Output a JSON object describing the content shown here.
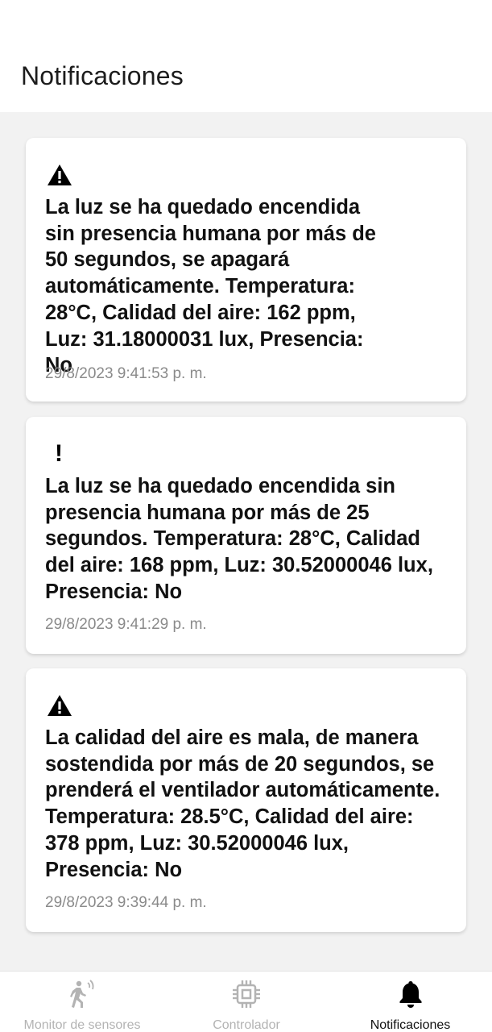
{
  "header": {
    "title": "Notificaciones"
  },
  "notifications": [
    {
      "icon": "warning-triangle-icon",
      "message": "La luz se ha quedado encendida sin presencia humana por más de 50 segundos, se apagará automáticamente. Temperatura: 28°C, Calidad del aire: 162 ppm, Luz: 31.18000031 lux, Presencia: No",
      "timestamp": "29/8/2023 9:41:53 p. m."
    },
    {
      "icon": "exclamation-icon",
      "icon_glyph": "!",
      "message": "La luz se ha quedado encendida sin presencia humana por más de 25 segundos. Temperatura: 28°C, Calidad del aire: 168 ppm, Luz: 30.52000046 lux, Presencia: No",
      "timestamp": "29/8/2023 9:41:29 p. m."
    },
    {
      "icon": "warning-triangle-icon",
      "message": "La calidad del aire es mala, de manera sostendida por más de 20 segundos, se prenderá el ventilador automáticamente. Temperatura: 28.5°C, Calidad del aire: 378 ppm, Luz: 30.52000046 lux, Presencia: No",
      "timestamp": "29/8/2023 9:39:44 p. m."
    }
  ],
  "bottom_nav": {
    "items": [
      {
        "label": "Monitor de sensores",
        "icon": "person-sensor-icon",
        "active": false
      },
      {
        "label": "Controlador",
        "icon": "chip-icon",
        "active": false
      },
      {
        "label": "Notificaciones",
        "icon": "bell-icon",
        "active": true
      }
    ]
  },
  "colors": {
    "background": "#f2f2f2",
    "card": "#ffffff",
    "text": "#111111",
    "timestamp": "#8a8a8a",
    "nav_inactive": "#b3b3b3",
    "nav_active": "#111111"
  }
}
